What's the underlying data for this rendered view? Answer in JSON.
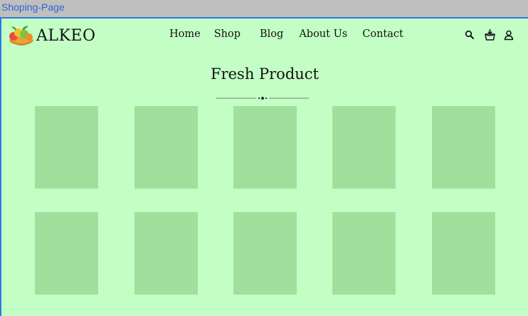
{
  "window": {
    "title": "Shoping-Page"
  },
  "header": {
    "brand": "ALKEO",
    "nav": [
      "Home",
      "Shop",
      "Blog",
      "About Us",
      "Contact"
    ],
    "icons": [
      "search-icon",
      "cart-icon",
      "user-icon"
    ]
  },
  "main": {
    "section_title": "Fresh Product",
    "product_cards": 10
  },
  "colors": {
    "page_background": "#c3ffc4",
    "card_background": "#a0e09d",
    "tab_title": "#2f63d6",
    "frame_border": "#2d7ae0"
  }
}
